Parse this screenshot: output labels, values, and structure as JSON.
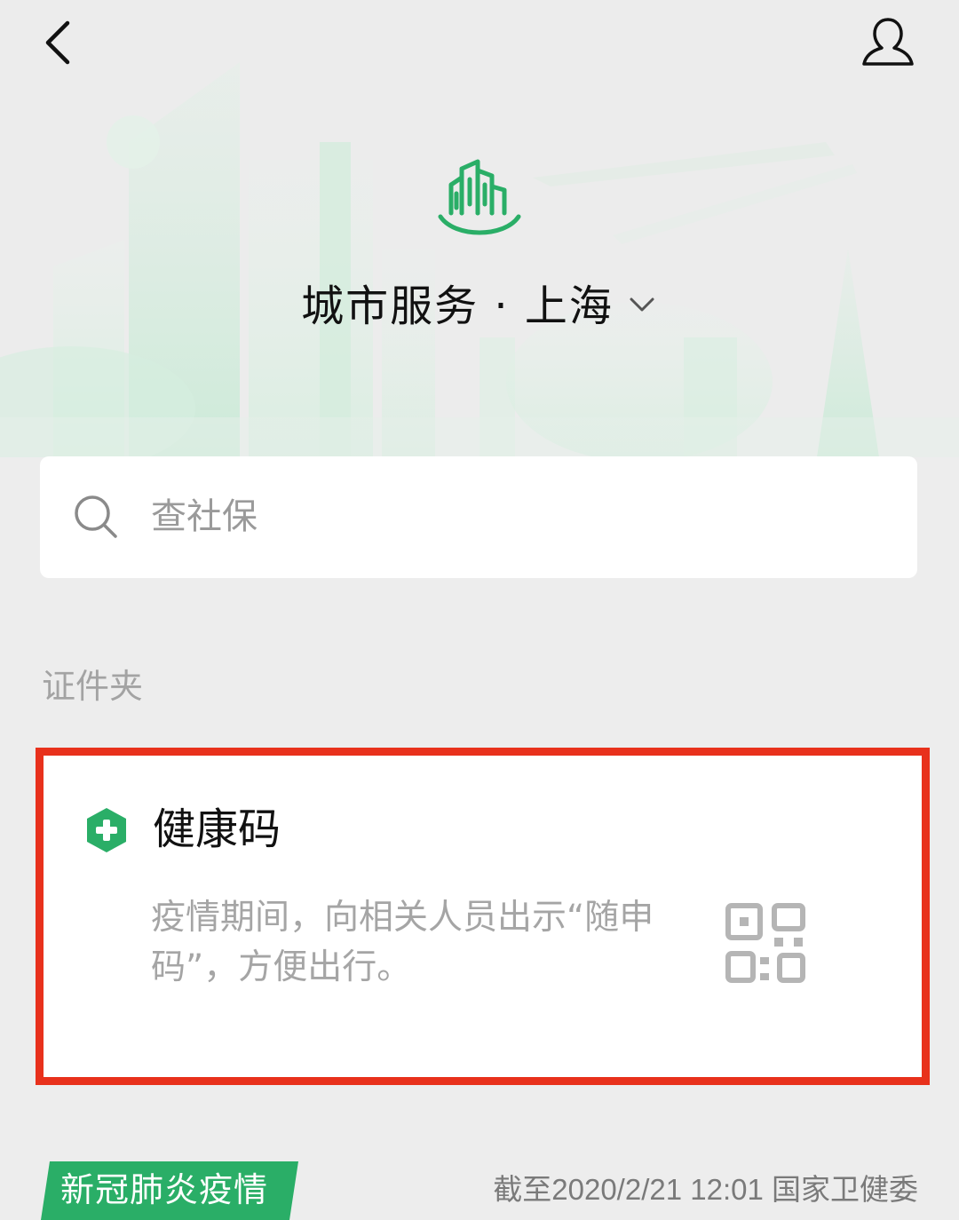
{
  "header": {
    "back_icon": "chevron-left-icon",
    "profile_icon": "user-icon"
  },
  "city": {
    "logo_icon": "city-buildings-icon",
    "title": "城市服务 · 上海",
    "dropdown_icon": "chevron-down-icon"
  },
  "search": {
    "icon": "search-icon",
    "placeholder": "查社保"
  },
  "wallet": {
    "section_label": "证件夹",
    "health_code": {
      "icon": "shield-plus-icon",
      "title": "健康码",
      "description": "疫情期间，向相关人员出示“随申码”，方便出行。",
      "qr_icon": "qr-code-icon"
    }
  },
  "covid": {
    "tag": "新冠肺炎疫情",
    "source": "截至2020/2/21 12:01 国家卫健委"
  },
  "colors": {
    "brand_green": "#2aae67",
    "highlight_red": "#e8311c",
    "background": "#ededed"
  }
}
